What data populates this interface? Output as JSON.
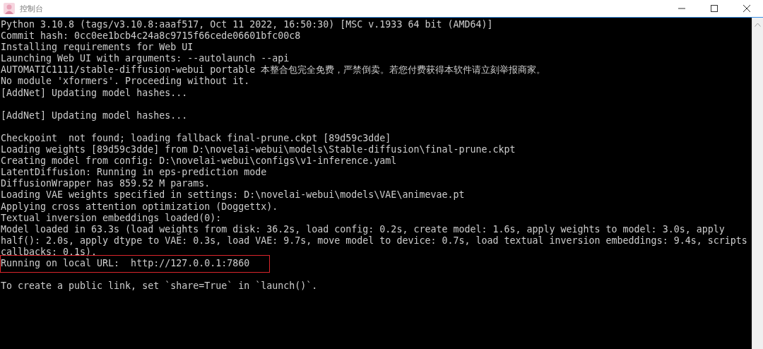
{
  "window": {
    "title": "控制台"
  },
  "console": {
    "lines": [
      {
        "kind": "text",
        "text": "Python 3.10.8 (tags/v3.10.8:aaaf517, Oct 11 2022, 16:50:30) [MSC v.1933 64 bit (AMD64)]",
        "highlighted": false
      },
      {
        "kind": "text",
        "text": "Commit hash: 0cc0ee1bcb4c24a8c9715f66cede06601bfc00c8",
        "highlighted": false
      },
      {
        "kind": "text",
        "text": "Installing requirements for Web UI",
        "highlighted": false
      },
      {
        "kind": "text",
        "text": "Launching Web UI with arguments: --autolaunch --api",
        "highlighted": false
      },
      {
        "kind": "text",
        "text": "AUTOMATIC1111/stable-diffusion-webui portable 本整合包完全免费，严禁倒卖。若您付费获得本软件请立刻举报商家。",
        "highlighted": false
      },
      {
        "kind": "text",
        "text": "No module 'xformers'. Proceeding without it.",
        "highlighted": false
      },
      {
        "kind": "text",
        "text": "[AddNet] Updating model hashes...",
        "highlighted": false
      },
      {
        "kind": "blank"
      },
      {
        "kind": "text",
        "text": "[AddNet] Updating model hashes...",
        "highlighted": false
      },
      {
        "kind": "blank"
      },
      {
        "kind": "text",
        "text": "Checkpoint  not found; loading fallback final-prune.ckpt [89d59c3dde]",
        "highlighted": false
      },
      {
        "kind": "text",
        "text": "Loading weights [89d59c3dde] from D:\\novelai-webui\\models\\Stable-diffusion\\final-prune.ckpt",
        "highlighted": false
      },
      {
        "kind": "text",
        "text": "Creating model from config: D:\\novelai-webui\\configs\\v1-inference.yaml",
        "highlighted": false
      },
      {
        "kind": "text",
        "text": "LatentDiffusion: Running in eps-prediction mode",
        "highlighted": false
      },
      {
        "kind": "text",
        "text": "DiffusionWrapper has 859.52 M params.",
        "highlighted": false
      },
      {
        "kind": "text",
        "text": "Loading VAE weights specified in settings: D:\\novelai-webui\\models\\VAE\\animevae.pt",
        "highlighted": false
      },
      {
        "kind": "text",
        "text": "Applying cross attention optimization (Doggettx).",
        "highlighted": false
      },
      {
        "kind": "text",
        "text": "Textual inversion embeddings loaded(0):",
        "highlighted": false
      },
      {
        "kind": "text",
        "text": "Model loaded in 63.3s (load weights from disk: 36.2s, load config: 0.2s, create model: 1.6s, apply weights to model: 3.0s, apply",
        "highlighted": false
      },
      {
        "kind": "text",
        "text": "half(): 2.0s, apply dtype to VAE: 0.3s, load VAE: 9.7s, move model to device: 0.7s, load textual inversion embeddings: 9.4s, scripts",
        "highlighted": false
      },
      {
        "kind": "text",
        "text": "callbacks: 0.1s).",
        "highlighted": false
      },
      {
        "kind": "text",
        "text": "Running on local URL:  http://127.0.0.1:7860",
        "highlighted": true
      },
      {
        "kind": "blank"
      },
      {
        "kind": "text",
        "text": "To create a public link, set `share=True` in `launch()`.",
        "highlighted": false
      }
    ]
  }
}
